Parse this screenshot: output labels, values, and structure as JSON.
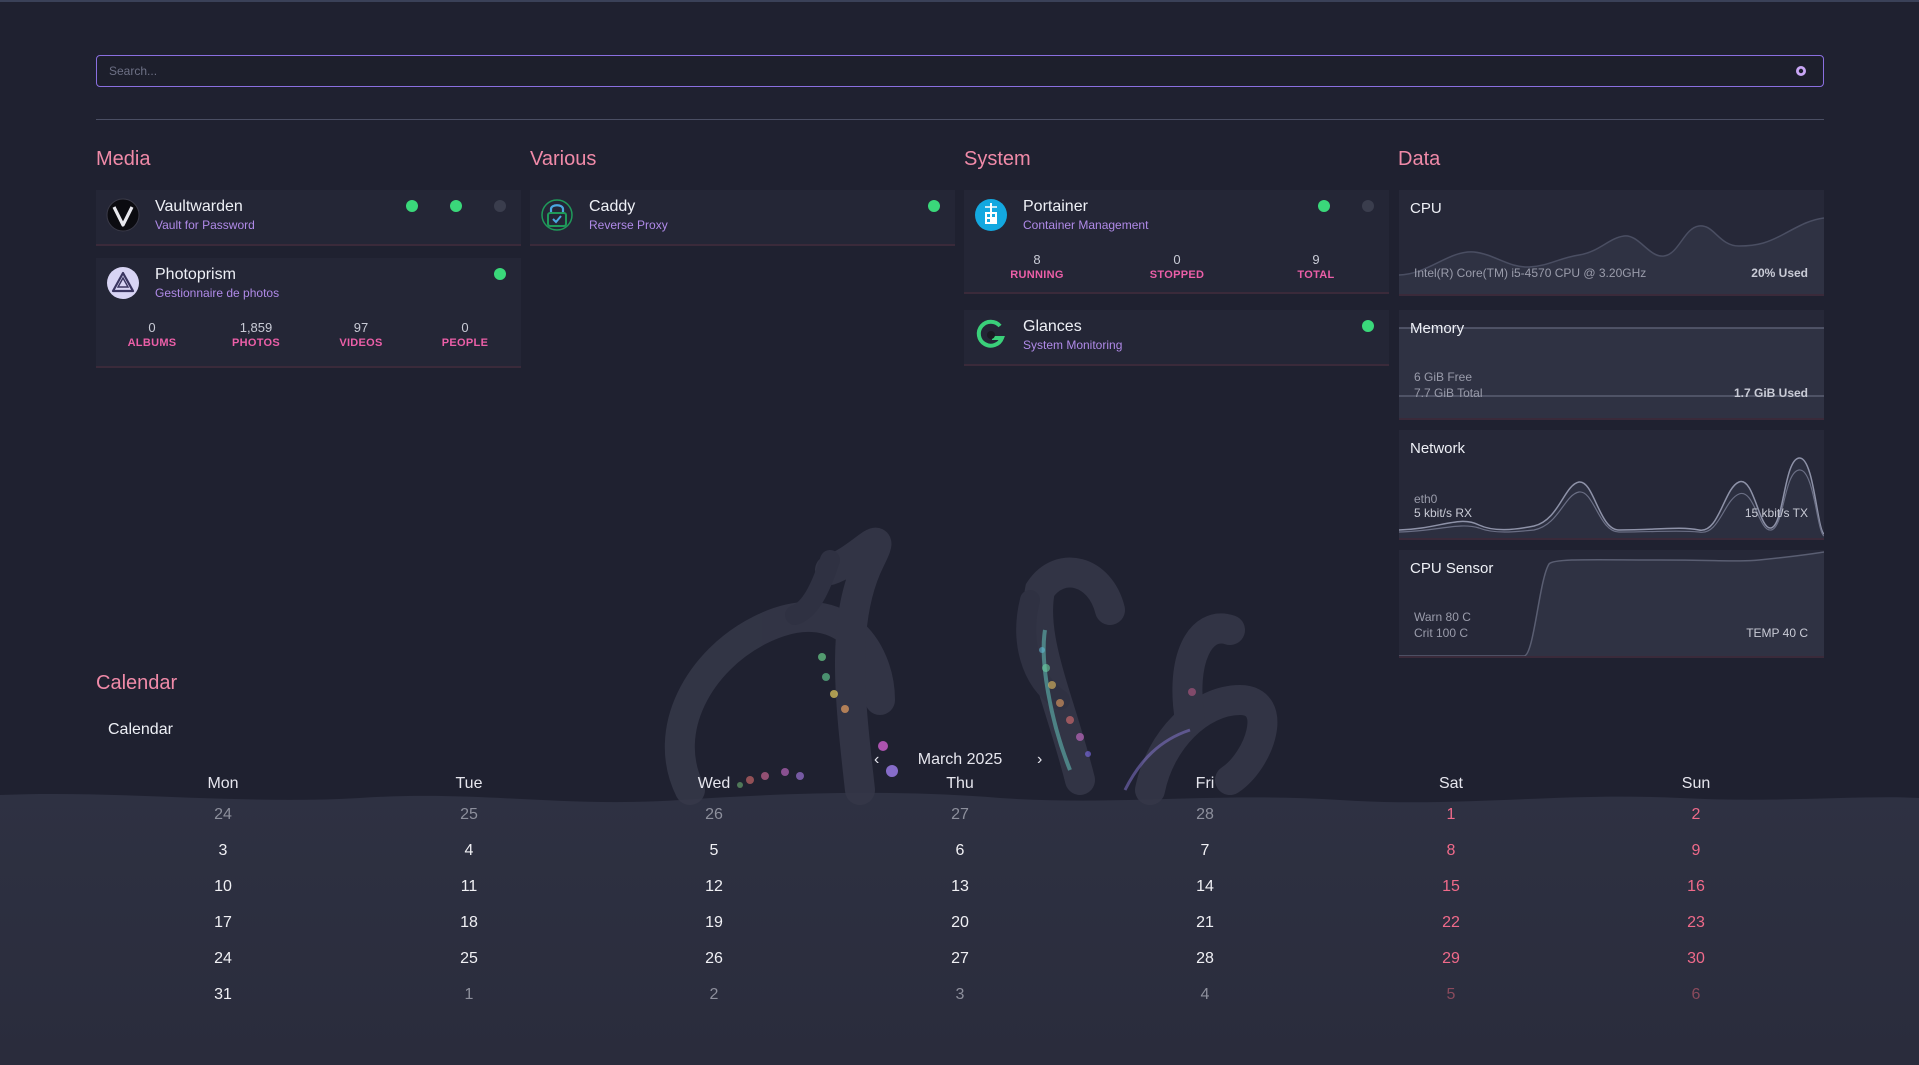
{
  "search": {
    "placeholder": "Search...",
    "icon": "search-icon"
  },
  "sections": {
    "media": "Media",
    "various": "Various",
    "system": "System",
    "data": "Data",
    "calendar": "Calendar"
  },
  "services": {
    "vaultwarden": {
      "name": "Vaultwarden",
      "desc": "Vault for Password",
      "icon": "vaultwarden-logo-icon",
      "status": [
        "online",
        "online",
        "offline"
      ]
    },
    "photoprism": {
      "name": "Photoprism",
      "desc": "Gestionnaire de photos",
      "icon": "photoprism-logo-icon",
      "status": [
        "online"
      ],
      "stats": [
        {
          "value": "0",
          "label": "ALBUMS"
        },
        {
          "value": "1,859",
          "label": "PHOTOS"
        },
        {
          "value": "97",
          "label": "VIDEOS"
        },
        {
          "value": "0",
          "label": "PEOPLE"
        }
      ]
    },
    "caddy": {
      "name": "Caddy",
      "desc": "Reverse Proxy",
      "icon": "caddy-lock-icon",
      "status": [
        "online"
      ]
    },
    "portainer": {
      "name": "Portainer",
      "desc": "Container Management",
      "icon": "portainer-logo-icon",
      "status": [
        "online",
        "offline"
      ],
      "stats": [
        {
          "value": "8",
          "label": "RUNNING"
        },
        {
          "value": "0",
          "label": "STOPPED"
        },
        {
          "value": "9",
          "label": "TOTAL"
        }
      ]
    },
    "glances": {
      "name": "Glances",
      "desc": "System Monitoring",
      "icon": "glances-logo-icon",
      "status": [
        "online"
      ]
    }
  },
  "data_widgets": {
    "cpu": {
      "title": "CPU",
      "model": "Intel(R) Core(TM) i5-4570 CPU @ 3.20GHz",
      "usage": "20% Used"
    },
    "memory": {
      "title": "Memory",
      "free": "6 GiB Free",
      "total": "7.7 GiB Total",
      "used": "1.7 GiB Used"
    },
    "network": {
      "title": "Network",
      "iface": "eth0",
      "rx": "5 kbit/s RX",
      "tx": "15 kbit/s TX"
    },
    "sensor": {
      "title": "CPU Sensor",
      "warn": "Warn 80 C",
      "crit": "Crit 100 C",
      "temp": "TEMP 40 C"
    }
  },
  "calendar": {
    "title": "Calendar",
    "month": "March 2025",
    "prev_icon": "‹",
    "next_icon": "›",
    "days_of_week": [
      "Mon",
      "Tue",
      "Wed",
      "Thu",
      "Fri",
      "Sat",
      "Sun"
    ],
    "weeks": [
      [
        "24",
        "25",
        "26",
        "27",
        "28",
        "1",
        "2"
      ],
      [
        "3",
        "4",
        "5",
        "6",
        "7",
        "8",
        "9"
      ],
      [
        "10",
        "11",
        "12",
        "13",
        "14",
        "15",
        "16"
      ],
      [
        "17",
        "18",
        "19",
        "20",
        "21",
        "22",
        "23"
      ],
      [
        "24",
        "25",
        "26",
        "27",
        "28",
        "29",
        "30"
      ],
      [
        "31",
        "1",
        "2",
        "3",
        "4",
        "5",
        "6"
      ]
    ],
    "other_month": [
      [
        true,
        true,
        true,
        true,
        true,
        false,
        false
      ],
      [
        false,
        false,
        false,
        false,
        false,
        false,
        false
      ],
      [
        false,
        false,
        false,
        false,
        false,
        false,
        false
      ],
      [
        false,
        false,
        false,
        false,
        false,
        false,
        false
      ],
      [
        false,
        false,
        false,
        false,
        false,
        false,
        false
      ],
      [
        false,
        true,
        true,
        true,
        true,
        true,
        true
      ]
    ]
  },
  "colors": {
    "accent_title": "#f08aa8",
    "description": "#b08ae8",
    "stat_label": "#ec5fa8",
    "online": "#3ad87a",
    "offline": "#3a3d4d",
    "weekend": "#f06a8a"
  }
}
